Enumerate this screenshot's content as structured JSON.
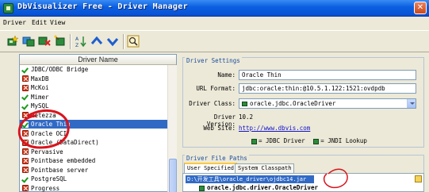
{
  "window": {
    "title": "DbVisualizer Free - Driver Manager",
    "close_glyph": "✕"
  },
  "menu": {
    "items": [
      "Driver",
      "Edit",
      "View"
    ]
  },
  "toolbar": {
    "buttons": [
      "new-driver-icon",
      "copy-driver-icon",
      "delete-driver-icon",
      "driver-wizard-icon",
      "sort-icon",
      "move-up-icon",
      "move-down-icon",
      "search-icon"
    ]
  },
  "driver_list": {
    "header": "Driver Name",
    "items": [
      {
        "label": "JDBC/ODBC Bridge",
        "status": "ok"
      },
      {
        "label": "MaxDB",
        "status": "err"
      },
      {
        "label": "McKoi",
        "status": "err"
      },
      {
        "label": "Mimer",
        "status": "ok"
      },
      {
        "label": "MySQL",
        "status": "ok"
      },
      {
        "label": "Netezza",
        "status": "err"
      },
      {
        "label": "Oracle Thin",
        "status": "ok",
        "selected": true
      },
      {
        "label": "Oracle OCI",
        "status": "err"
      },
      {
        "label": "Oracle (DataDirect)",
        "status": "err"
      },
      {
        "label": "Pervasive",
        "status": "err"
      },
      {
        "label": "Pointbase embedded",
        "status": "err"
      },
      {
        "label": "Pointbase server",
        "status": "err"
      },
      {
        "label": "PostgreSQL",
        "status": "ok"
      },
      {
        "label": "Progress",
        "status": "err"
      }
    ]
  },
  "driver_settings": {
    "title": "Driver Settings",
    "name_label": "Name:",
    "name_value": "Oracle Thin",
    "url_label": "URL Format:",
    "url_value": "jdbc:oracle:thin:@10.5.1.122:1521:ovdpdb",
    "class_label": "Driver Class:",
    "class_value": "oracle.jdbc.OracleDriver",
    "version_label": "Driver Version:",
    "version_value": "10.2",
    "site_label": "Web Site:",
    "site_value": "http://www.dbvis.com",
    "legend_jdbc": "= JDBC Driver",
    "legend_jndi": "= JNDI Lookup"
  },
  "file_paths": {
    "title": "Driver File Paths",
    "tabs": [
      "User Specified",
      "System Classpath"
    ],
    "jar_path": "D:\\开发工具\\oracle_driver\\ojdbc14.jar",
    "class_entry": "oracle.jdbc.driver.OracleDriver"
  },
  "colors": {
    "selection": "#316ac5",
    "annotation": "#d8141e",
    "titlebar": "#0a5fe0"
  }
}
